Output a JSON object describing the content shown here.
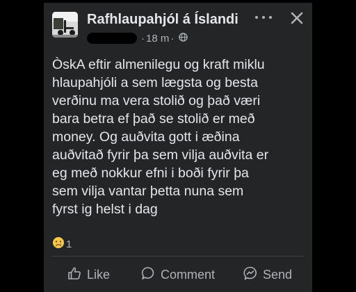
{
  "post": {
    "group_name": "Rafhlaupahjól á Íslandi",
    "time": "18 m",
    "separator": "·",
    "text_lines": [
      "ÒskA eftir almenilegu og kraft miklu",
      "hlaupahjóli a sem lægsta og besta",
      "verðinu ma vera stolið og það væri",
      "bara betra ef það se stolið er með",
      "money. Og auðvita gott i æðina",
      "auðvitað fyrir þa sem vilja auðvita er",
      "eg með nokkur efni i boði fyrir þa",
      "sem vilja vantar þetta nuna sem",
      "fyrst ig helst i dag"
    ],
    "reaction_count": "1",
    "reaction_icon": "sad-face-emoji"
  },
  "actions": {
    "like_label": "Like",
    "comment_label": "Comment",
    "send_label": "Send"
  },
  "colors": {
    "card_bg": "#242526",
    "text": "#e4e6eb",
    "secondary_text": "#b0b3b8",
    "page_bg": "#000000"
  }
}
